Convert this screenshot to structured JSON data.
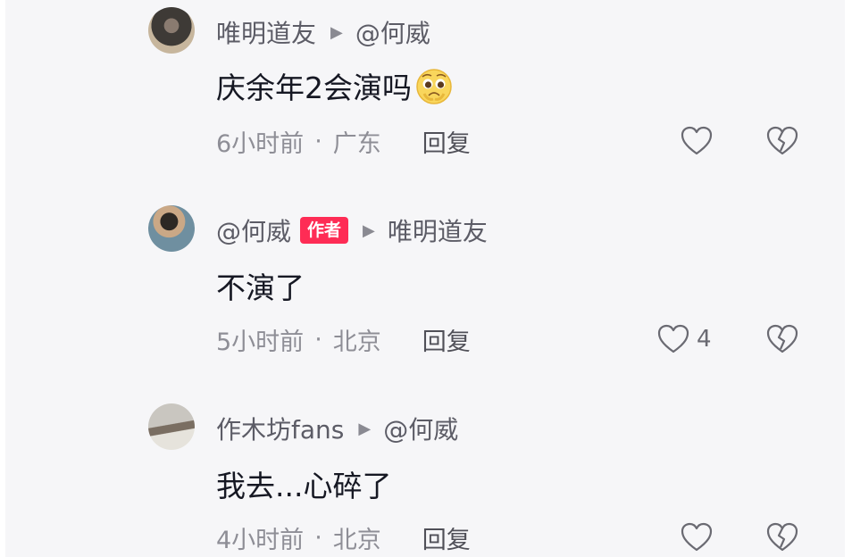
{
  "comments": [
    {
      "author": "唯明道友",
      "reply_to": "@何威",
      "text": "庆余年2会演吗",
      "emoji": "pleading-emoji",
      "time": "6小时前",
      "location": "广东",
      "reply_label": "回复",
      "likes": ""
    },
    {
      "author": "@何威",
      "badge": "作者",
      "reply_to": "唯明道友",
      "text": "不演了",
      "time": "5小时前",
      "location": "北京",
      "reply_label": "回复",
      "likes": "4"
    },
    {
      "author": "作木坊fans",
      "reply_to": "@何威",
      "text": "我去...心碎了",
      "time": "4小时前",
      "location": "北京",
      "reply_label": "回复",
      "likes": ""
    }
  ],
  "meta_separator": "·",
  "reply_arrow": "▶",
  "colors": {
    "badge": "#fe2c55",
    "text": "#161823",
    "muted": "#8e8e96",
    "background": "#f6f6f8"
  },
  "icons": [
    "heart-icon",
    "broken-heart-icon"
  ]
}
